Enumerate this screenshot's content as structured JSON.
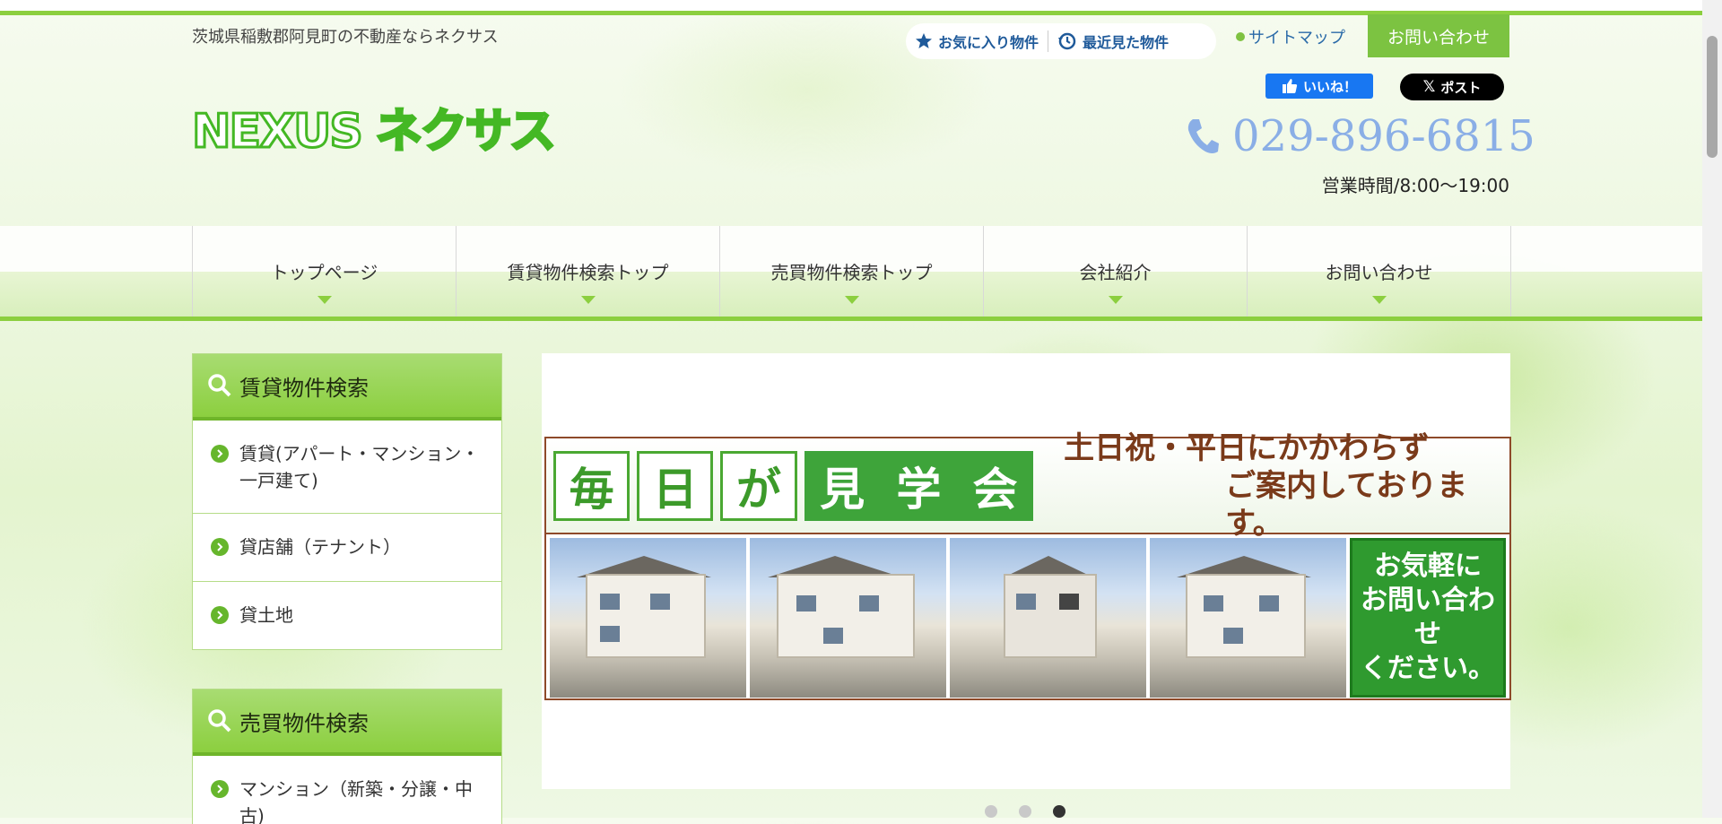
{
  "header": {
    "tagline": "茨城県稲敷郡阿見町の不動産ならネクサス",
    "logo": "NEXUS ネクサス",
    "favorites_label": "お気に入り物件",
    "recent_label": "最近見た物件",
    "sitemap_label": "サイトマップ",
    "contact_label": "お問い合わせ",
    "like_label": "いいね！",
    "post_label": "ポスト",
    "phone": "029-896-6815",
    "hours": "営業時間/8:00〜19:00"
  },
  "nav": {
    "items": [
      {
        "label": "トップページ"
      },
      {
        "label": "賃貸物件検索トップ"
      },
      {
        "label": "売買物件検索トップ"
      },
      {
        "label": "会社紹介"
      },
      {
        "label": "お問い合わせ"
      }
    ]
  },
  "sidebar": {
    "rent": {
      "title": "賃貸物件検索",
      "items": [
        {
          "label": "賃貸(アパート・マンション・一戸建て)"
        },
        {
          "label": "貸店舗（テナント）"
        },
        {
          "label": "貸土地"
        }
      ]
    },
    "sale": {
      "title": "売買物件検索",
      "items": [
        {
          "label": "マンション（新築・分譲・中古)"
        }
      ]
    }
  },
  "banner": {
    "chars": [
      "毎",
      "日",
      "が",
      "見",
      "学",
      "会"
    ],
    "line1": "土日祝・平日にかかわらず",
    "line2": "ご案内しております。",
    "cta_line1": "お気軽に",
    "cta_line2": "お問い合わせ",
    "cta_line3": "ください。"
  },
  "slider": {
    "count": 3,
    "active_index": 2
  },
  "colors": {
    "accent": "#8ccf3f",
    "phone": "#8aaee6",
    "link": "#2a6aa8"
  }
}
